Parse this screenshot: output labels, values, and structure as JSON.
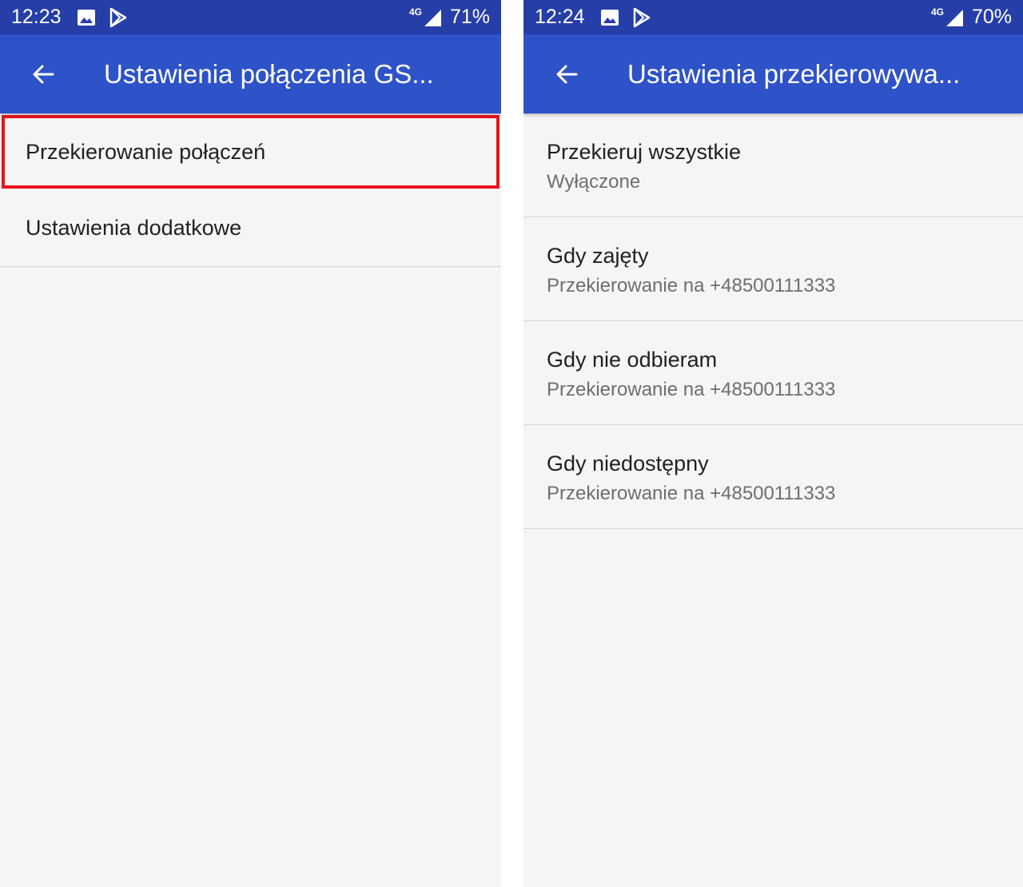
{
  "left_screen": {
    "status_bar": {
      "time": "12:23",
      "network": "4G",
      "battery": "71%",
      "icons": [
        "image-icon",
        "play-store-icon",
        "signal-icon"
      ]
    },
    "app_bar": {
      "back_icon": "arrow-back-icon",
      "title": "Ustawienia połączenia GS..."
    },
    "items": [
      {
        "label": "Przekierowanie połączeń",
        "highlighted": true,
        "highlight_color": "#e8141b"
      },
      {
        "label": "Ustawienia dodatkowe"
      }
    ]
  },
  "right_screen": {
    "status_bar": {
      "time": "12:24",
      "network": "4G",
      "battery": "70%",
      "icons": [
        "image-icon",
        "play-store-icon",
        "signal-icon"
      ]
    },
    "app_bar": {
      "back_icon": "arrow-back-icon",
      "title": "Ustawienia przekierowywa..."
    },
    "items": [
      {
        "label": "Przekieruj wszystkie",
        "summary": "Wyłączone"
      },
      {
        "label": "Gdy zajęty",
        "summary": "Przekierowanie na +48500111333"
      },
      {
        "label": "Gdy nie odbieram",
        "summary": "Przekierowanie na +48500111333"
      },
      {
        "label": "Gdy niedostępny",
        "summary": "Przekierowanie na +48500111333"
      }
    ]
  },
  "colors": {
    "status_bar": "#253ea8",
    "app_bar": "#2e52c8",
    "background": "#f5f5f5",
    "highlight": "#e8141b"
  }
}
